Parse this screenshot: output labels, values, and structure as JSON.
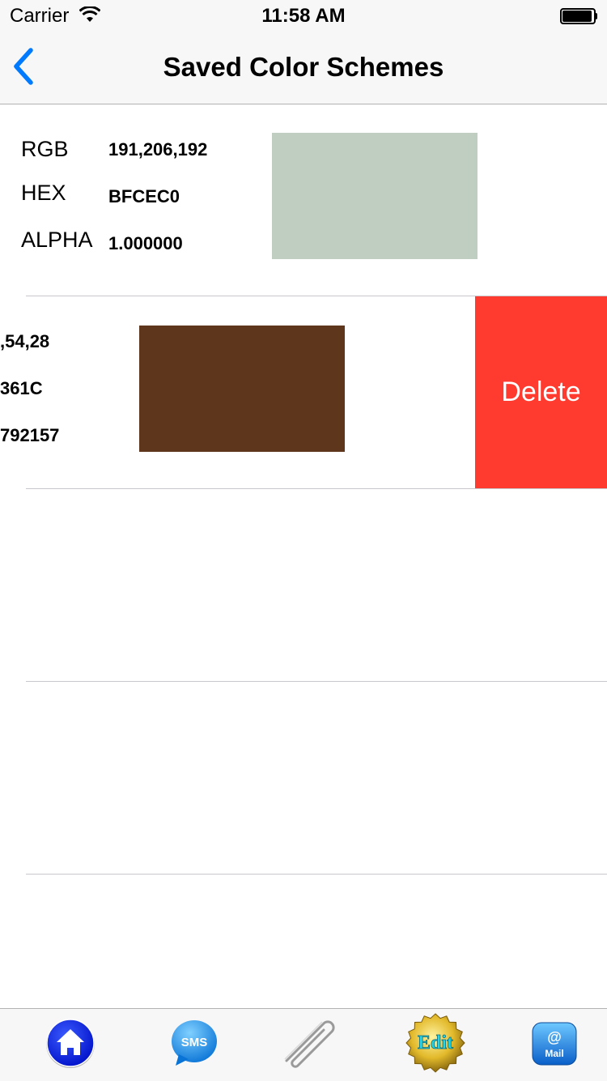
{
  "status_bar": {
    "carrier": "Carrier",
    "time": "11:58 AM"
  },
  "nav": {
    "title": "Saved Color Schemes",
    "back_icon": "chevron-left-icon"
  },
  "labels": {
    "rgb": "RGB",
    "hex": "HEX",
    "alpha": "ALPHA"
  },
  "schemes": [
    {
      "rgb": "191,206,192",
      "hex": "BFCEC0",
      "alpha": "1.000000",
      "swatch_color": "#BFCEC0"
    },
    {
      "rgb_visible": ",54,28",
      "hex_visible": "361C",
      "alpha_visible": "792157",
      "swatch_color": "#5E361C",
      "delete_label": "Delete",
      "delete_color": "#FF3B30"
    }
  ],
  "toolbar": {
    "home_icon": "home-icon",
    "sms_label": "SMS",
    "attach_icon": "paperclip-icon",
    "edit_label": "Edit",
    "mail_symbol": "@",
    "mail_label": "Mail"
  },
  "colors": {
    "accent": "#007AFF",
    "separator": "#C8C7CC",
    "bar_background": "#F7F7F7"
  }
}
